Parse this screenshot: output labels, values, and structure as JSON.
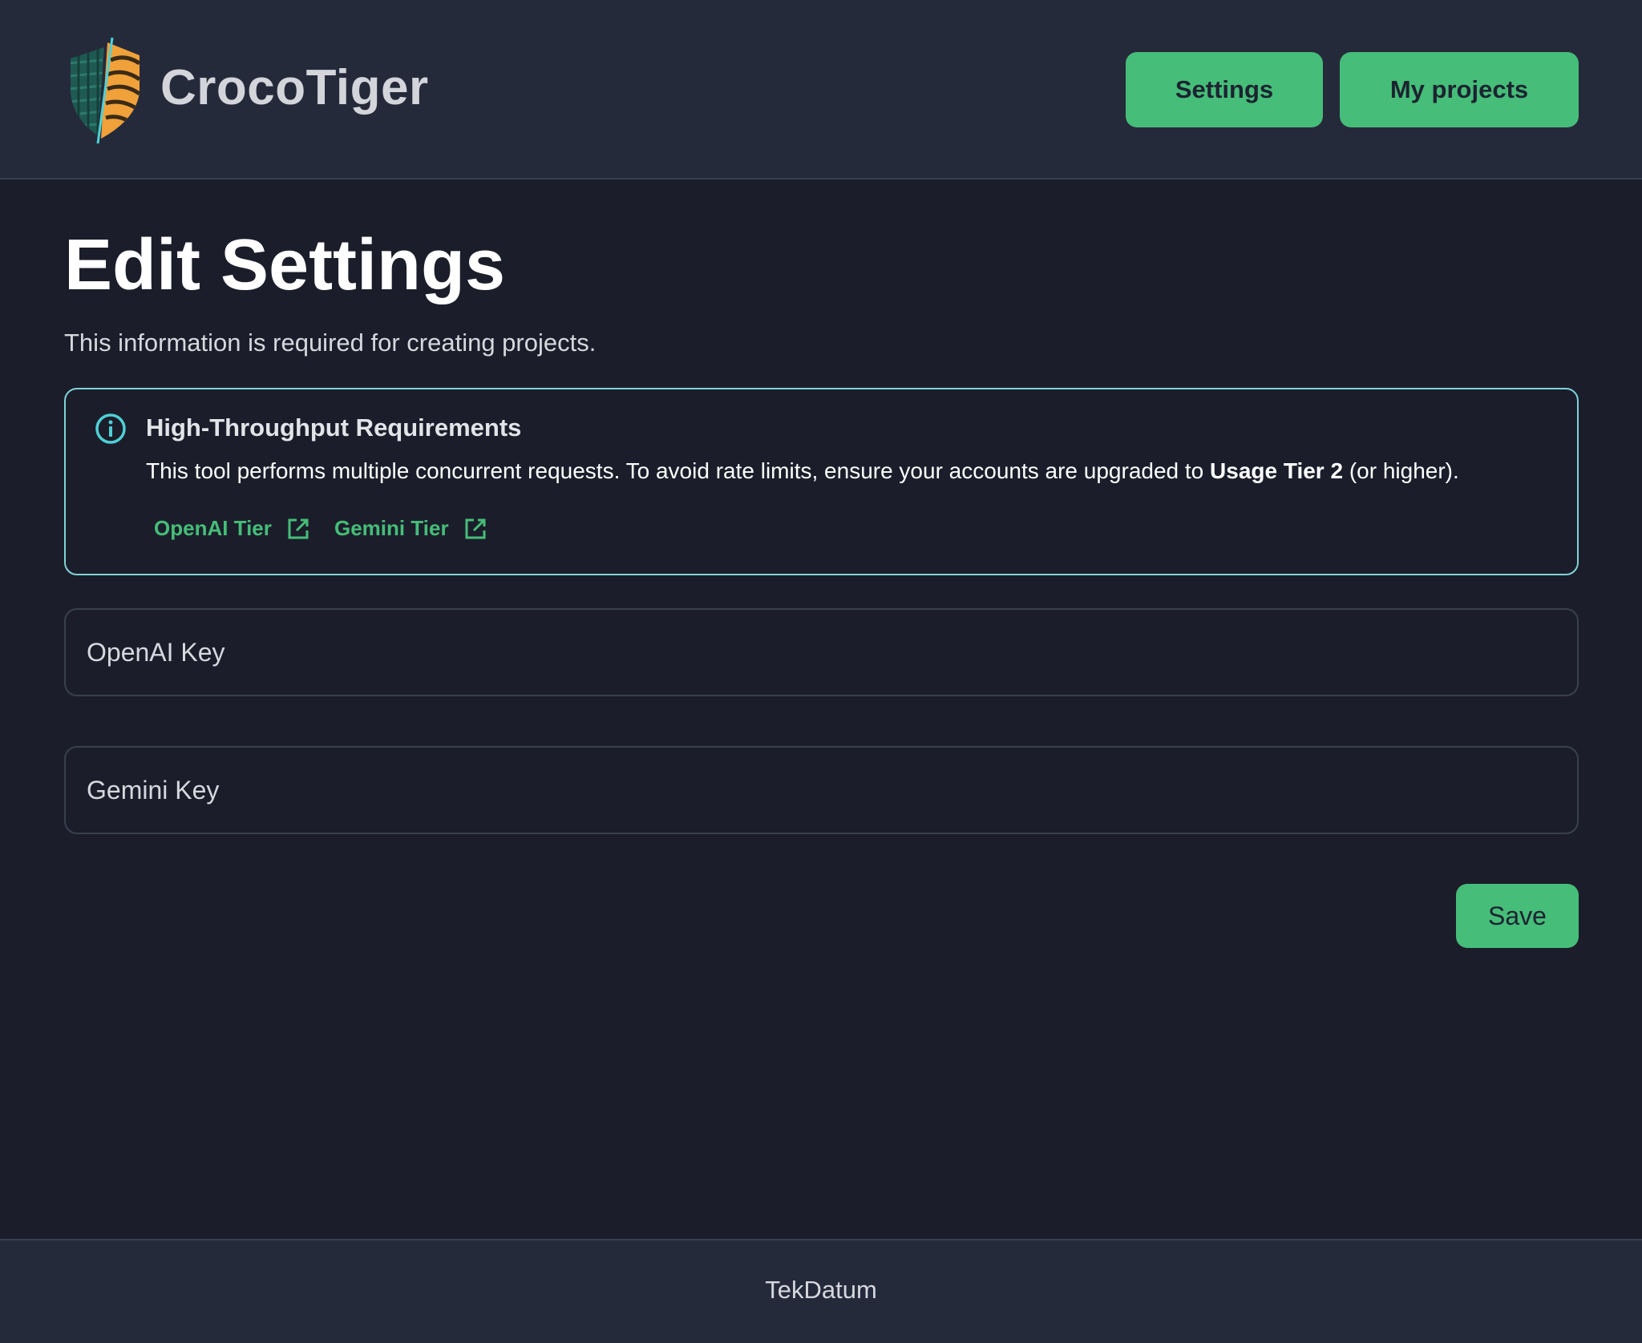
{
  "header": {
    "brand": "CrocoTiger",
    "nav": {
      "settings_label": "Settings",
      "projects_label": "My projects"
    }
  },
  "main": {
    "title": "Edit Settings",
    "subtitle": "This information is required for creating projects.",
    "notice": {
      "icon": "info-icon",
      "title": "High-Throughput Requirements",
      "text_before": "This tool performs multiple concurrent requests. To avoid rate limits, ensure your accounts are upgraded to ",
      "text_bold": "Usage Tier 2",
      "text_after": " (or higher).",
      "links": [
        {
          "label": "OpenAI Tier",
          "icon": "external-link-icon"
        },
        {
          "label": "Gemini Tier",
          "icon": "external-link-icon"
        }
      ]
    },
    "fields": {
      "openai_placeholder": "OpenAI Key",
      "openai_value": "",
      "gemini_placeholder": "Gemini Key",
      "gemini_value": ""
    },
    "save_label": "Save"
  },
  "footer": {
    "text": "TekDatum"
  },
  "colors": {
    "background": "#1b1e2a",
    "header_bg": "#252a3b",
    "accent": "#46bd79",
    "notice_border": "#7fd3d9",
    "logo_dark": "#1f5a52",
    "logo_orange": "#f0a13a"
  }
}
